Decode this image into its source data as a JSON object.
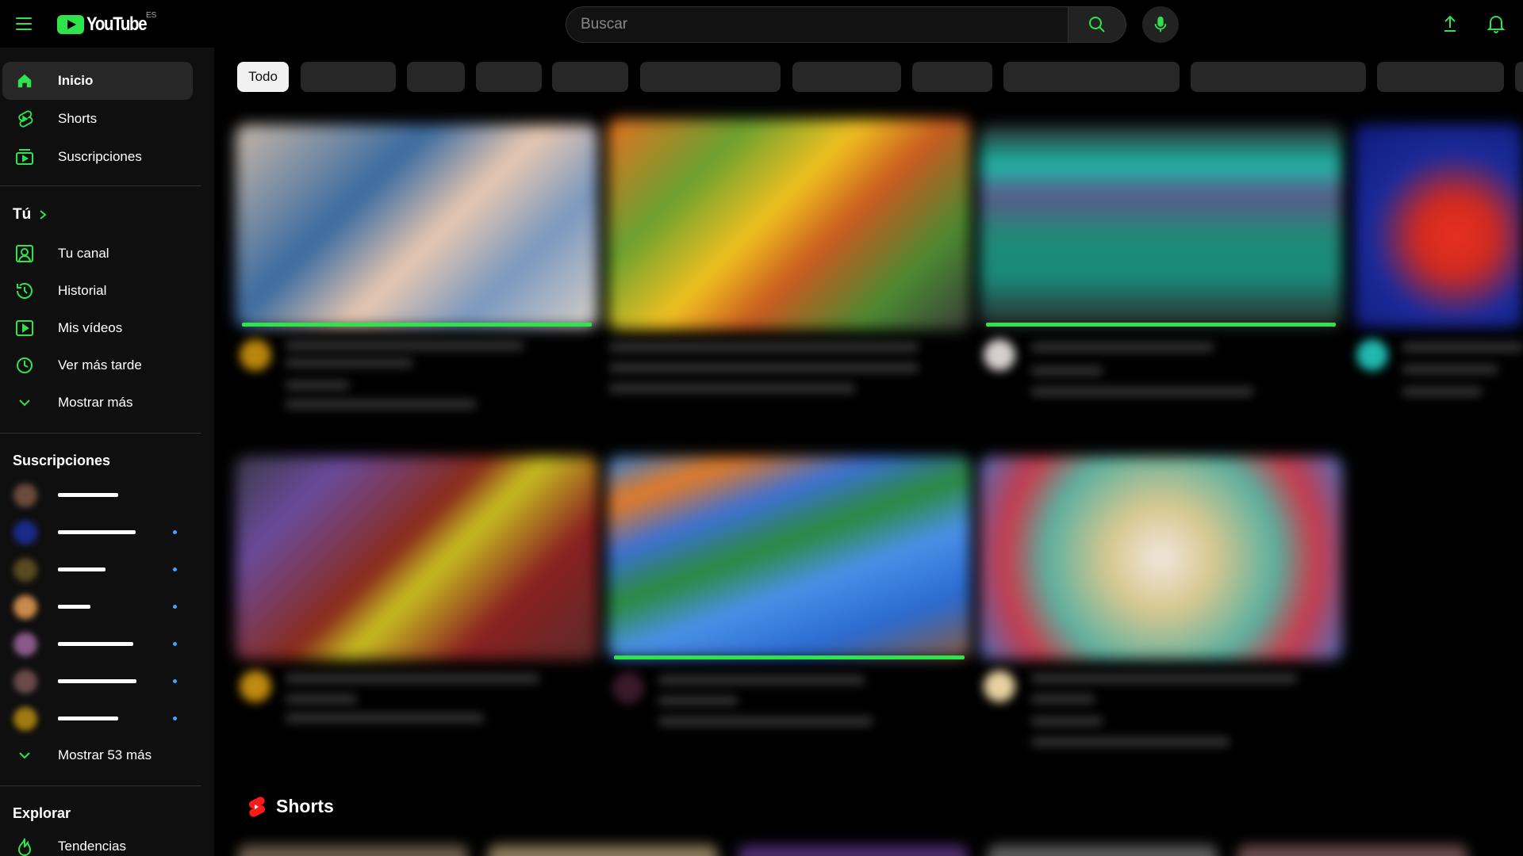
{
  "header": {
    "logo_text": "YouTube",
    "region": "ES",
    "search_placeholder": "Buscar",
    "accent_color": "#2fe34a"
  },
  "sidebar": {
    "main": [
      {
        "label": "Inicio",
        "icon": "home-icon",
        "active": true
      },
      {
        "label": "Shorts",
        "icon": "shorts-icon"
      },
      {
        "label": "Suscripciones",
        "icon": "subscriptions-icon"
      }
    ],
    "you_title": "Tú",
    "you": [
      {
        "label": "Tu canal",
        "icon": "channel-icon"
      },
      {
        "label": "Historial",
        "icon": "history-icon"
      },
      {
        "label": "Mis vídeos",
        "icon": "my-videos-icon"
      },
      {
        "label": "Ver más tarde",
        "icon": "watch-later-icon"
      },
      {
        "label": "Mostrar más",
        "icon": "chevron-down-icon"
      }
    ],
    "subs_title": "Suscripciones",
    "subs_more": "Mostrar 53 más",
    "explore_title": "Explorar",
    "explore": [
      {
        "label": "Tendencias",
        "icon": "trending-icon"
      }
    ]
  },
  "chips": {
    "active": "Todo"
  },
  "shorts": {
    "title": "Shorts"
  }
}
